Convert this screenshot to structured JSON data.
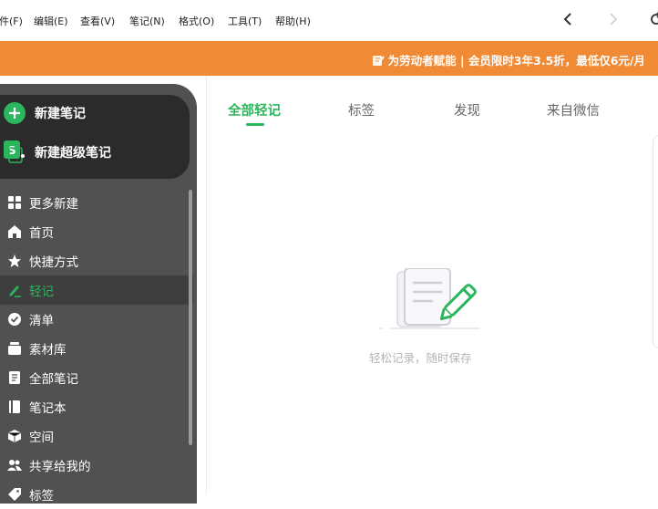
{
  "menubar": {
    "items": [
      "件(F)",
      "编辑(E)",
      "查看(V)",
      "笔记(N)",
      "格式(O)",
      "工具(T)",
      "帮助(H)"
    ],
    "back_icon": "chevron-left-icon",
    "forward_icon": "chevron-right-icon",
    "sync_icon": "refresh-icon"
  },
  "banner": {
    "text": "为劳动者赋能 | 会员限时3年3.5折，最低仅6元/月",
    "icon": "edit-note-icon"
  },
  "sidebar": {
    "new_note": "新建笔记",
    "new_super_note": "新建超级笔记",
    "items": [
      {
        "label": "更多新建",
        "icon": "grid-icon"
      },
      {
        "label": "首页",
        "icon": "home-icon"
      },
      {
        "label": "快捷方式",
        "icon": "star-icon"
      },
      {
        "label": "轻记",
        "icon": "pen-icon"
      },
      {
        "label": "清单",
        "icon": "check-circle-icon"
      },
      {
        "label": "素材库",
        "icon": "archive-icon"
      },
      {
        "label": "全部笔记",
        "icon": "document-icon"
      },
      {
        "label": "笔记本",
        "icon": "notebook-icon"
      },
      {
        "label": "空间",
        "icon": "cube-icon"
      },
      {
        "label": "共享给我的",
        "icon": "users-icon"
      },
      {
        "label": "标签",
        "icon": "tag-icon"
      }
    ],
    "active_index": 3
  },
  "tabs": [
    "全部轻记",
    "标签",
    "发现",
    "来自微信"
  ],
  "empty_state": {
    "text": "轻松记录，随时保存"
  },
  "colors": {
    "accent": "#2bb55c",
    "banner": "#f08a35",
    "sidebar": "#515151",
    "sidebar_dark": "#2b2b2b"
  }
}
